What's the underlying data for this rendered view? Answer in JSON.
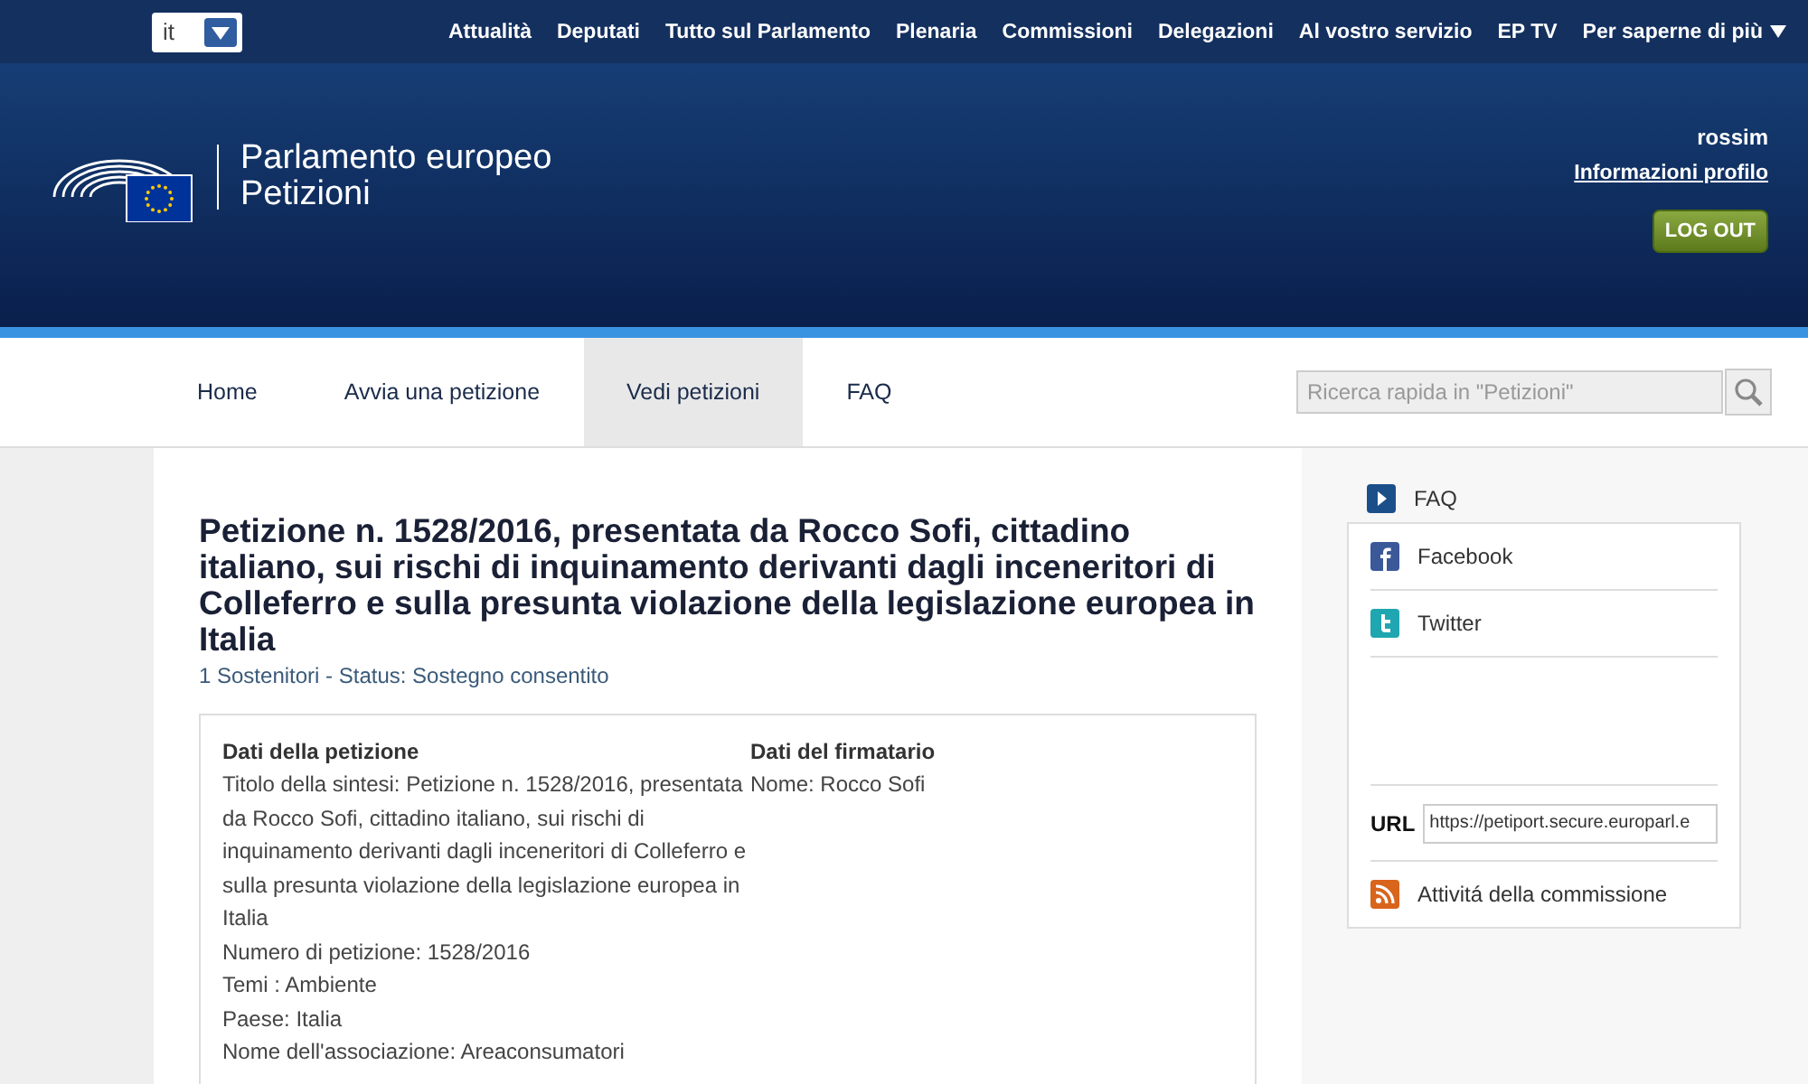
{
  "top_bar": {
    "language": "it",
    "menu": [
      {
        "label": "Attualità"
      },
      {
        "label": "Deputati"
      },
      {
        "label": "Tutto sul Parlamento"
      },
      {
        "label": "Plenaria"
      },
      {
        "label": "Commissioni"
      },
      {
        "label": "Delegazioni"
      },
      {
        "label": "Al vostro servizio"
      },
      {
        "label": "EP TV"
      },
      {
        "label": "Per saperne di più",
        "dropdown": true
      }
    ]
  },
  "header": {
    "title": "Parlamento europeo",
    "subtitle": "Petizioni",
    "user": "rossim",
    "profile_link": "Informazioni profilo",
    "logout": "LOG OUT"
  },
  "nav": {
    "tabs": [
      {
        "label": "Home",
        "selected": false
      },
      {
        "label": "Avvia una petizione",
        "selected": false
      },
      {
        "label": "Vedi petizioni",
        "selected": true
      },
      {
        "label": "FAQ",
        "selected": false
      }
    ],
    "search": {
      "placeholder": "Ricerca rapida in \"Petizioni\""
    }
  },
  "petition": {
    "title": "Petizione n. 1528/2016, presentata da Rocco Sofi, cittadino italiano, sui rischi di inquinamento derivanti dagli inceneritori di Colleferro e sulla presunta violazione della legislazione europea in Italia",
    "status": "1 Sostenitori - Status: Sostegno consentito",
    "sections": [
      {
        "heading": "Dati della petizione",
        "lines": [
          "Titolo della sintesi: Petizione n. 1528/2016, presentata da Rocco Sofi, cittadino italiano, sui rischi di inquinamento derivanti dagli inceneritori di Colleferro e sulla presunta violazione della legislazione europea in Italia",
          "Numero di petizione: 1528/2016",
          "Temi : Ambiente",
          "Paese: Italia",
          "Nome dell'associazione: Areaconsumatori"
        ]
      },
      {
        "heading": "Dati del firmatario",
        "lines": [
          "Nome: Rocco Sofi"
        ]
      }
    ]
  },
  "sidebar": {
    "faq": "FAQ",
    "items": [
      {
        "kind": "facebook",
        "label": "Facebook"
      },
      {
        "kind": "twitter",
        "label": "Twitter"
      },
      {
        "kind": "spacer"
      },
      {
        "kind": "url",
        "label": "URL",
        "value": "https://petiport.secure.europarl.e"
      },
      {
        "kind": "rss",
        "label": "Attivitá della commissione"
      }
    ]
  }
}
